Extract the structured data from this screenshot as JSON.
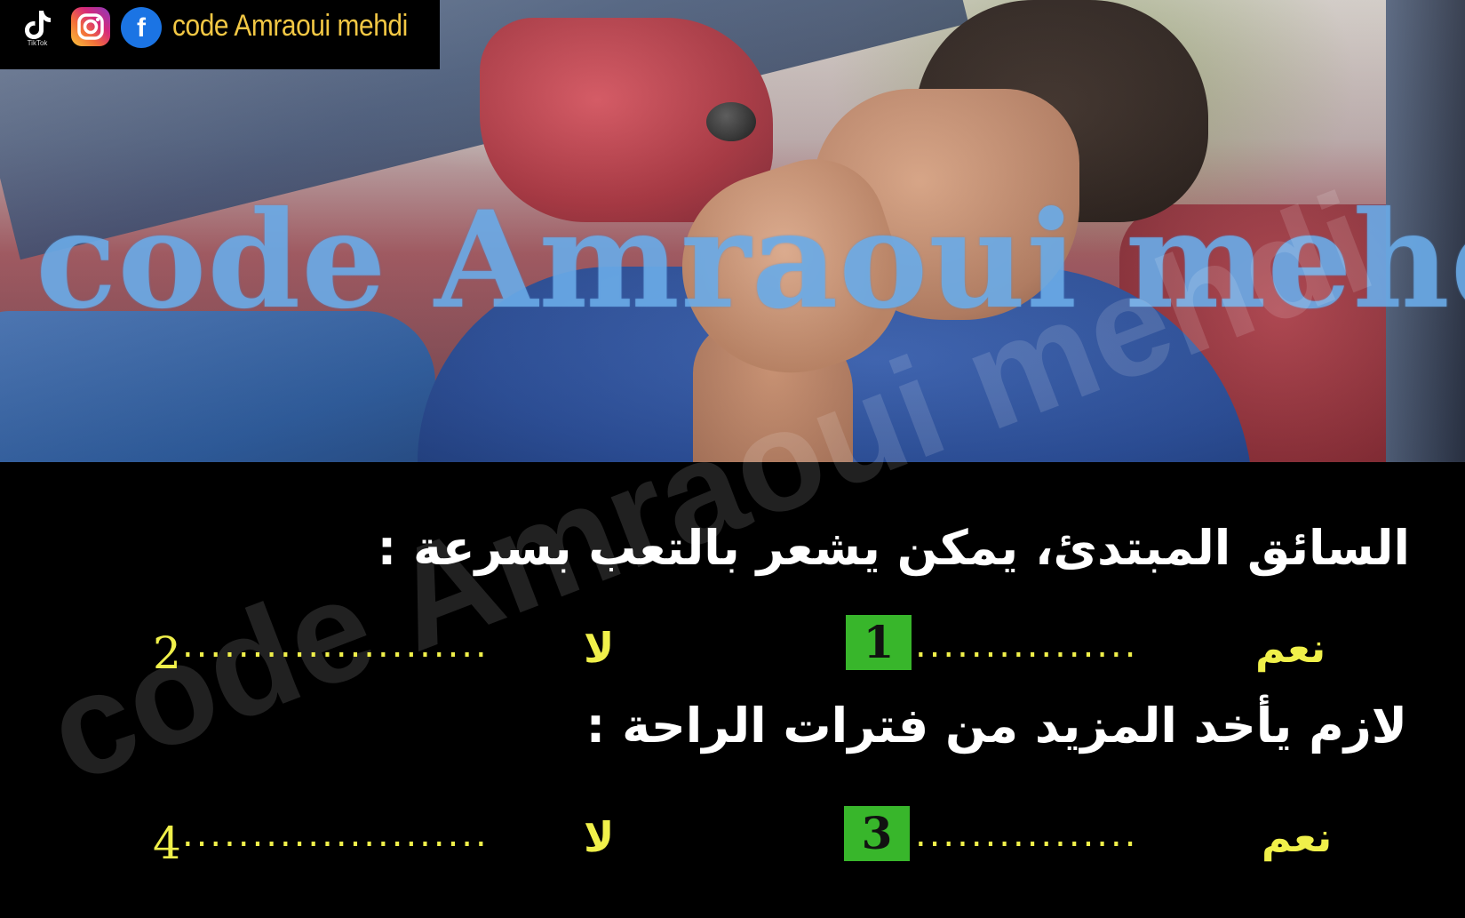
{
  "social": {
    "tiktok_label": "TikTok",
    "facebook_glyph": "f",
    "name": "code Amraoui mehdi"
  },
  "watermark": {
    "top": "code Amraoui mehdi",
    "bottom": "code Amraoui mehdi"
  },
  "quiz": {
    "q1": {
      "text": "السائق المبتدئ، يمكن يشعر بالتعب بسرعة :",
      "yes": {
        "word": "نعم",
        "dots": "................",
        "number": "1"
      },
      "no": {
        "word": "لا",
        "dots": "......................",
        "number": "2"
      }
    },
    "q2": {
      "text": "لازم يأخد المزيد من فترات الراحة :",
      "yes": {
        "word": "نعم",
        "dots": "................",
        "number": "3"
      },
      "no": {
        "word": "لا",
        "dots": "......................",
        "number": "4"
      }
    },
    "answers_highlighted": [
      "1",
      "3"
    ]
  },
  "colors": {
    "question_text": "#ffffff",
    "option_text": "#f0f04a",
    "badge_bg": "#38b62b",
    "social_name": "#f2c744",
    "watermark_top": "#6eafeb"
  },
  "icons": [
    "tiktok-icon",
    "instagram-icon",
    "facebook-icon"
  ]
}
